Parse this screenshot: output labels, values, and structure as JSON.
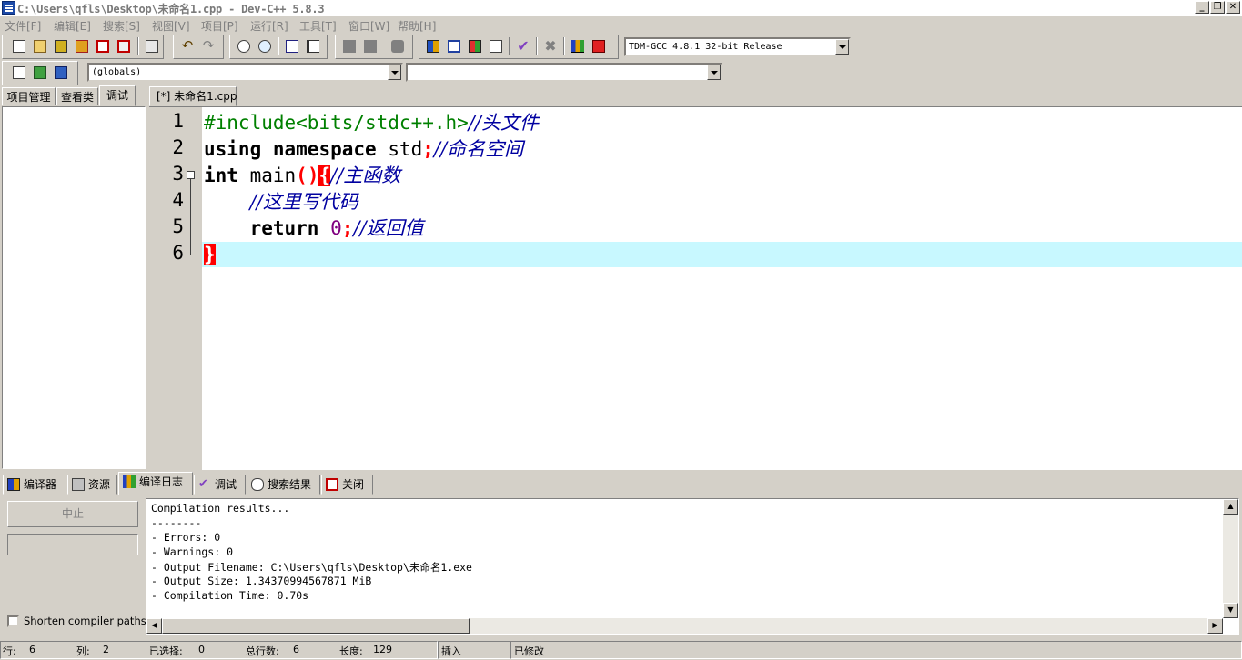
{
  "window": {
    "title": "C:\\Users\\qfls\\Desktop\\未命名1.cpp - Dev-C++ 5.8.3",
    "minimize_label": "_",
    "restore_label": "❐",
    "close_label": "✕"
  },
  "menu": [
    "文件[F]",
    "编辑[E]",
    "搜索[S]",
    "视图[V]",
    "项目[P]",
    "运行[R]",
    "工具[T]",
    "窗口[W]",
    "帮助[H]"
  ],
  "toolbar": {
    "compiler_select": "TDM-GCC 4.8.1 32-bit Release",
    "scope_select": "(globals)",
    "function_select": ""
  },
  "left_panel": {
    "tabs": [
      "项目管理",
      "查看类",
      "调试"
    ]
  },
  "editor": {
    "file_tab": "[*] 未命名1.cpp",
    "line_numbers": [
      "1",
      "2",
      "3",
      "4",
      "5",
      "6"
    ],
    "lines": {
      "l1_pp": "#include<bits/stdc++.h>",
      "l1_cm": "//头文件",
      "l2_kw1": "using",
      "l2_kw2": "namespace",
      "l2_id": "std",
      "l2_semi": ";",
      "l2_cm": "//命名空间",
      "l3_kw": "int",
      "l3_id": "main",
      "l3_paren": "()",
      "l3_brace": "{",
      "l3_cm": "//主函数",
      "l4_cm": "//这里写代码",
      "l5_kw": "return",
      "l5_num": "0",
      "l5_semi": ";",
      "l5_cm": "//返回值",
      "l6_brace": "}"
    }
  },
  "bottom": {
    "tabs": [
      "编译器",
      "资源",
      "编译日志",
      "调试",
      "搜索结果",
      "关闭"
    ],
    "abort_button": "中止",
    "shorten_label": "Shorten compiler paths",
    "log": [
      "Compilation results...",
      "--------",
      "- Errors: 0",
      "- Warnings: 0",
      "- Output Filename: C:\\Users\\qfls\\Desktop\\未命名1.exe",
      "- Output Size: 1.34370994567871 MiB",
      "- Compilation Time: 0.70s"
    ]
  },
  "status": {
    "row_label": "行:",
    "row_value": "6",
    "col_label": "列:",
    "col_value": "2",
    "sel_label": "已选择:",
    "sel_value": "0",
    "lines_label": "总行数:",
    "lines_value": "6",
    "len_label": "长度:",
    "len_value": "129",
    "mode": "插入",
    "modified": "已修改"
  }
}
